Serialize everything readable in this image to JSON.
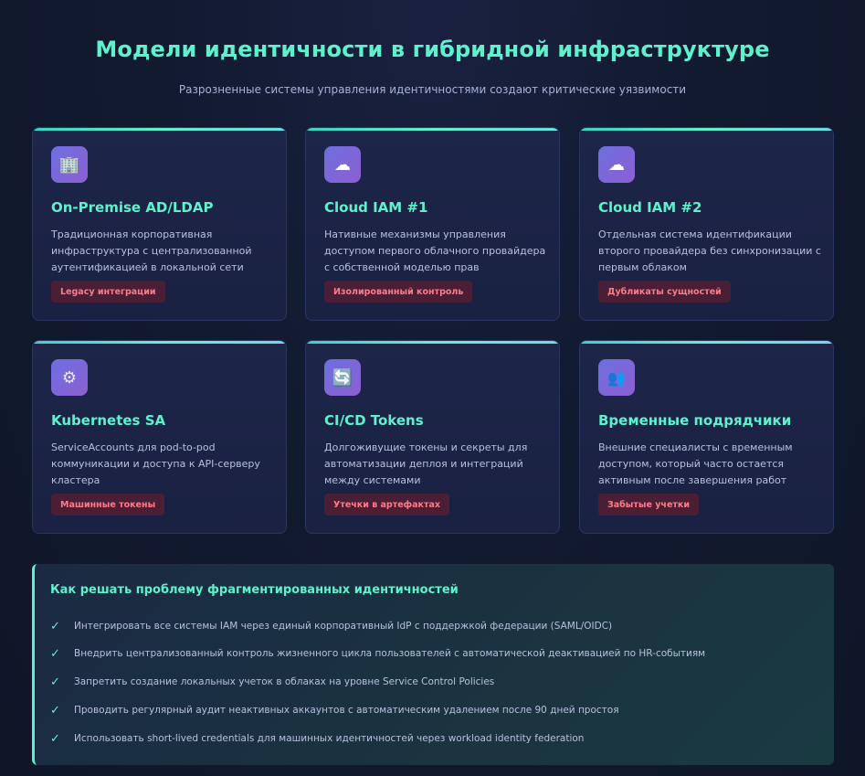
{
  "header": {
    "title": "Модели идентичности в гибридной инфраструктуре",
    "subtitle": "Разрозненные системы управления идентичностями создают критические уязвимости"
  },
  "cards": [
    {
      "icon": "office-building-icon",
      "icon_glyph": "🏢",
      "title": "On-Premise AD/LDAP",
      "description": "Традиционная корпоративная инфраструктура с централизованной аутентификацией в локальной сети",
      "tag": "Legacy интеграции"
    },
    {
      "icon": "cloud-icon",
      "icon_glyph": "☁",
      "title": "Cloud IAM #1",
      "description": "Нативные механизмы управления доступом первого облачного провайдера с собственной моделью прав",
      "tag": "Изолированный контроль"
    },
    {
      "icon": "cloud-icon",
      "icon_glyph": "☁",
      "title": "Cloud IAM #2",
      "description": "Отдельная система идентификации второго провайдера без синхронизации с первым облаком",
      "tag": "Дубликаты сущностей"
    },
    {
      "icon": "gear-icon",
      "icon_glyph": "⚙",
      "title": "Kubernetes SA",
      "description": "ServiceAccounts для pod-to-pod коммуникации и доступа к API-серверу кластера",
      "tag": "Машинные токены"
    },
    {
      "icon": "refresh-icon",
      "icon_glyph": "🔄",
      "title": "CI/CD Tokens",
      "description": "Долгоживущие токены и секреты для автоматизации деплоя и интеграций между системами",
      "tag": "Утечки в артефактах"
    },
    {
      "icon": "people-icon",
      "icon_glyph": "👥",
      "title": "Временные подрядчики",
      "description": "Внешние специалисты с временным доступом, который часто остается активным после завершения работ",
      "tag": "Забытые учетки"
    }
  ],
  "solution": {
    "title": "Как решать проблему фрагментированных идентичностей",
    "check_glyph": "✓",
    "items": [
      "Интегрировать все системы IAM через единый корпоративный IdP с поддержкой федерации (SAML/OIDC)",
      "Внедрить централизованный контроль жизненного цикла пользователей с автоматической деактивацией по HR-событиям",
      "Запретить создание локальных учеток в облаках на уровне Service Control Policies",
      "Проводить регулярный аудит неактивных аккаунтов с автоматическим удалением после 90 дней простоя",
      "Использовать short-lived credentials для машинных идентичностей через workload identity federation"
    ]
  },
  "colors": {
    "accent": "#5ef2cc",
    "card_bg": "#1d2549",
    "tag_bg": "#4a1f35",
    "tag_text": "#ff7a8a",
    "icon_gradient_start": "#6d6fe0",
    "icon_gradient_end": "#8d5fd1"
  }
}
